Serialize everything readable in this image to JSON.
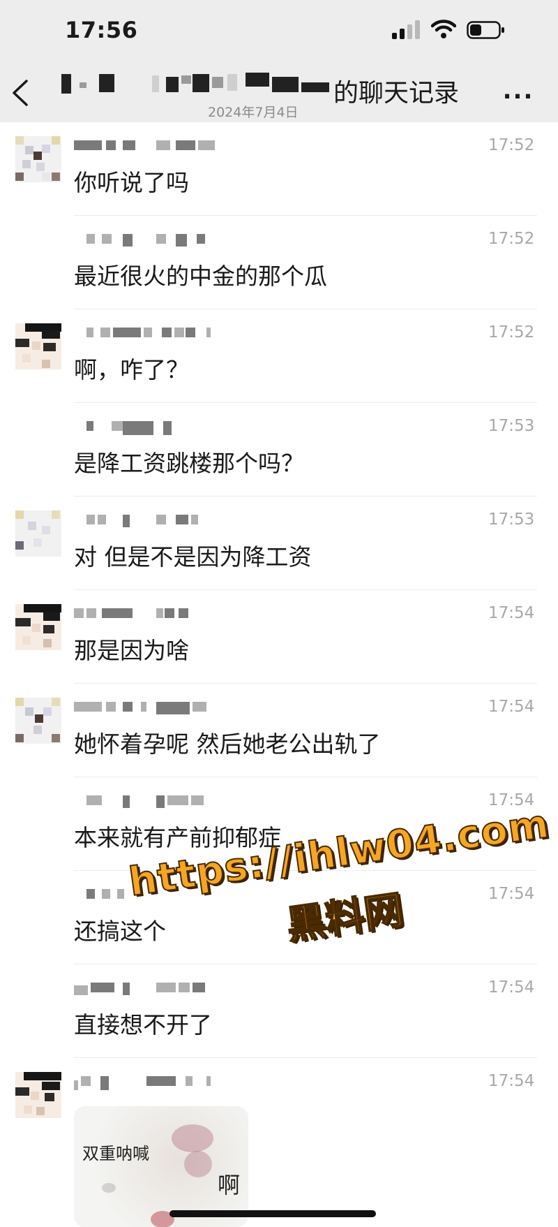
{
  "status_bar": {
    "time": "17:56"
  },
  "nav": {
    "title_suffix": "的聊天记录",
    "date": "2024年7月4日",
    "more_label": "..."
  },
  "messages": [
    {
      "time": "17:52",
      "text": "你听说了吗"
    },
    {
      "time": "17:52",
      "text": "最近很火的中金的那个瓜"
    },
    {
      "time": "17:52",
      "text": "啊，咋了？"
    },
    {
      "time": "17:53",
      "text": "是降工资跳楼那个吗？"
    },
    {
      "time": "17:53",
      "text": "对 但是不是因为降工资"
    },
    {
      "time": "17:54",
      "text": "那是因为啥"
    },
    {
      "time": "17:54",
      "text": "她怀着孕呢 然后她老公出轨了"
    },
    {
      "time": "17:54",
      "text": "本来就有产前抑郁症"
    },
    {
      "time": "17:54",
      "text": "还搞这个"
    },
    {
      "time": "17:54",
      "text": "直接想不开了"
    },
    {
      "time": "17:54",
      "text": ""
    }
  ],
  "sticker": {
    "top_text": "双重呐喊",
    "bottom_text": "啊"
  },
  "watermark": {
    "url": "https://ihlw04.com",
    "name": "黑料网"
  },
  "colors": {
    "header_bg": "#ededed",
    "watermark": "#f5a623"
  }
}
